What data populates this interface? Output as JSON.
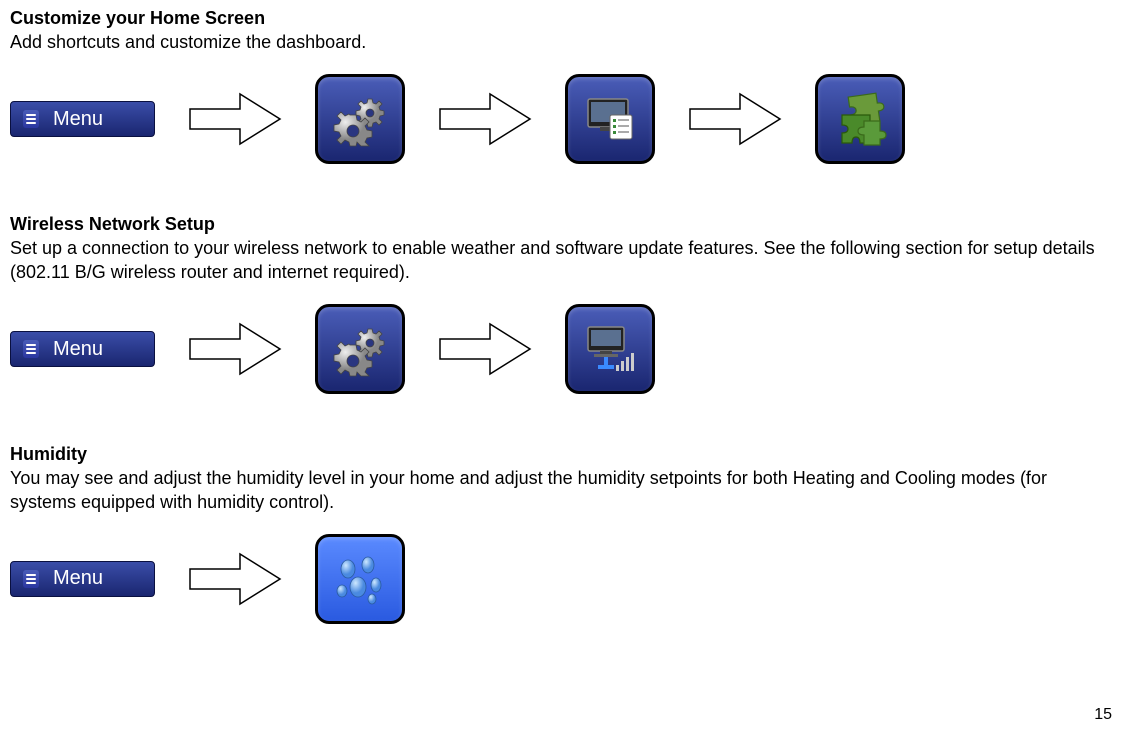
{
  "sections": [
    {
      "title": "Customize your Home Screen",
      "desc": "Add shortcuts and customize the dashboard.",
      "menu_label": "Menu",
      "steps": [
        "settings",
        "dashboard",
        "puzzle"
      ]
    },
    {
      "title": "Wireless Network Setup",
      "desc": "Set up a connection to your wireless network to enable weather and software update features. See the following section for setup details (802.11 B/G wireless router and internet required).",
      "menu_label": "Menu",
      "steps": [
        "settings",
        "network"
      ]
    },
    {
      "title": "Humidity",
      "desc": "You may see and adjust the humidity level in your home and adjust the humidity setpoints for both Heating and Cooling modes (for systems equipped with humidity control).",
      "menu_label": "Menu",
      "steps": [
        "humidity"
      ]
    }
  ],
  "page_number": "15"
}
